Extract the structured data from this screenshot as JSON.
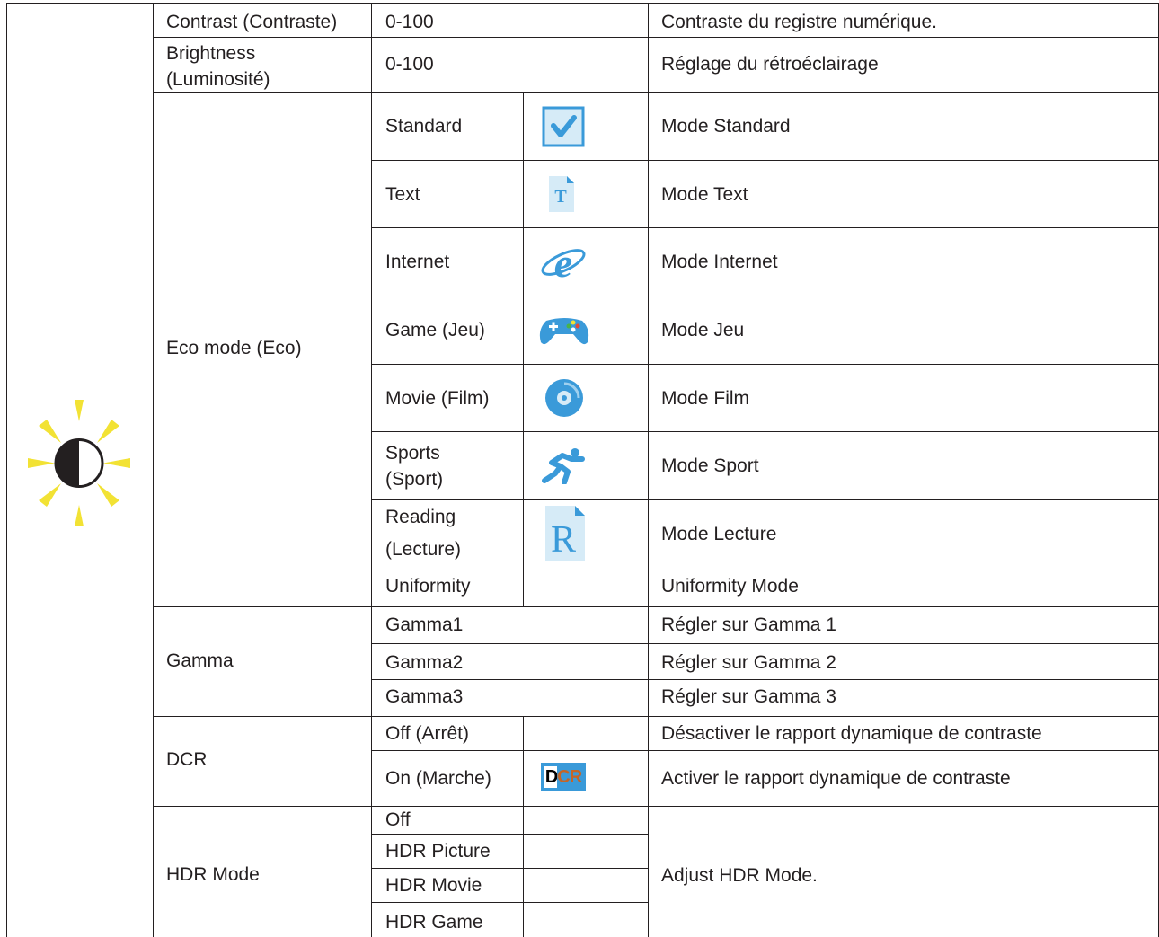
{
  "section_icon": "brightness-contrast-sun-icon",
  "colors": {
    "line": "#231f20",
    "text": "#231f20",
    "icon_blue": "#3a9ad9",
    "sun_yellow": "#f2e234"
  },
  "rows": {
    "contrast": {
      "label": "Contrast (Contraste)",
      "range": "0-100",
      "description": "Contraste du registre numérique."
    },
    "brightness": {
      "label_line1": "Brightness",
      "label_line2": "(Luminosité)",
      "range": "0-100",
      "description": "Réglage du rétroéclairage"
    },
    "eco": {
      "label": "Eco mode (Eco)",
      "items": [
        {
          "name": "Standard",
          "icon": "checkbox-icon",
          "description": "Mode Standard"
        },
        {
          "name": "Text",
          "icon": "text-document-icon",
          "description": "Mode Text"
        },
        {
          "name": "Internet",
          "icon": "internet-explorer-icon",
          "description": "Mode Internet"
        },
        {
          "name": "Game (Jeu)",
          "icon": "gamepad-icon",
          "description": "Mode Jeu"
        },
        {
          "name": "Movie (Film)",
          "icon": "disc-icon",
          "description": "Mode Film"
        },
        {
          "name_line1": "Sports",
          "name_line2": "(Sport)",
          "icon": "runner-icon",
          "description": "Mode Sport"
        },
        {
          "name_line1": "Reading",
          "name_line2": "(Lecture)",
          "icon": "reading-document-icon",
          "description": "Mode Lecture"
        },
        {
          "name": "Uniformity",
          "description": "Uniformity Mode"
        }
      ]
    },
    "gamma": {
      "label": "Gamma",
      "items": [
        {
          "name": "Gamma1",
          "description": "Régler sur Gamma 1"
        },
        {
          "name": "Gamma2",
          "description": "Régler sur Gamma 2"
        },
        {
          "name": "Gamma3",
          "description": "Régler sur Gamma 3"
        }
      ]
    },
    "dcr": {
      "label": "DCR",
      "items": [
        {
          "name": "Off (Arrêt)",
          "description": "Désactiver le rapport dynamique de contraste"
        },
        {
          "name": "On (Marche)",
          "icon": "dcr-icon",
          "icon_text": "DCR",
          "description": "Activer le rapport dynamique de contraste"
        }
      ]
    },
    "hdr": {
      "label": "HDR Mode",
      "items": [
        "Off",
        "HDR Picture",
        "HDR Movie",
        "HDR Game"
      ],
      "description": "Adjust HDR Mode."
    }
  }
}
